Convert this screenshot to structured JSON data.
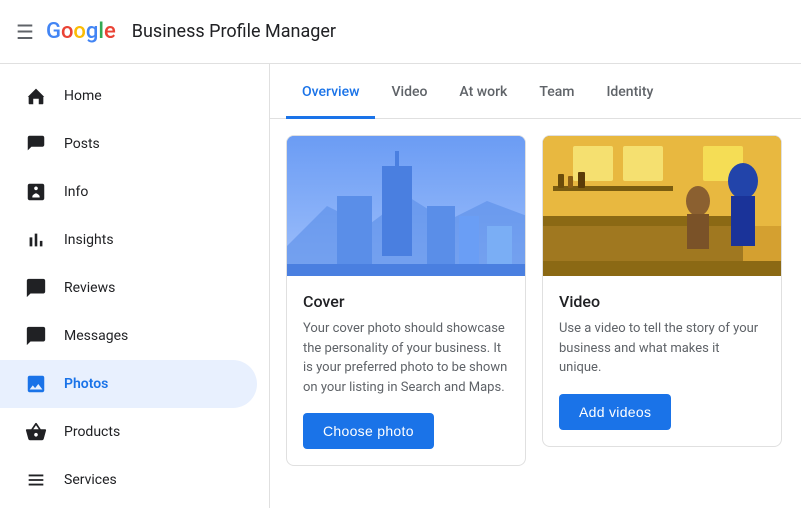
{
  "topbar": {
    "menu_icon": "☰",
    "google_letters": [
      "G",
      "o",
      "o",
      "g",
      "l",
      "e"
    ],
    "title": "Business Profile Manager"
  },
  "sidebar": {
    "items": [
      {
        "id": "home",
        "label": "Home",
        "icon": "grid"
      },
      {
        "id": "posts",
        "label": "Posts",
        "icon": "posts"
      },
      {
        "id": "info",
        "label": "Info",
        "icon": "info"
      },
      {
        "id": "insights",
        "label": "Insights",
        "icon": "insights"
      },
      {
        "id": "reviews",
        "label": "Reviews",
        "icon": "reviews"
      },
      {
        "id": "messages",
        "label": "Messages",
        "icon": "messages"
      },
      {
        "id": "photos",
        "label": "Photos",
        "icon": "photos",
        "active": true
      },
      {
        "id": "products",
        "label": "Products",
        "icon": "products"
      },
      {
        "id": "services",
        "label": "Services",
        "icon": "services"
      }
    ]
  },
  "tabs": {
    "items": [
      {
        "id": "overview",
        "label": "Overview",
        "active": true
      },
      {
        "id": "video",
        "label": "Video",
        "active": false
      },
      {
        "id": "at-work",
        "label": "At work",
        "active": false
      },
      {
        "id": "team",
        "label": "Team",
        "active": false
      },
      {
        "id": "identity",
        "label": "Identity",
        "active": false
      }
    ]
  },
  "cards": [
    {
      "id": "cover",
      "title": "Cover",
      "description": "Your cover photo should showcase the personality of your business. It is your preferred photo to be shown on your listing in Search and Maps.",
      "button_label": "Choose photo"
    },
    {
      "id": "video",
      "title": "Video",
      "description": "Use a video to tell the story of your business and what makes it unique.",
      "button_label": "Add videos"
    }
  ]
}
